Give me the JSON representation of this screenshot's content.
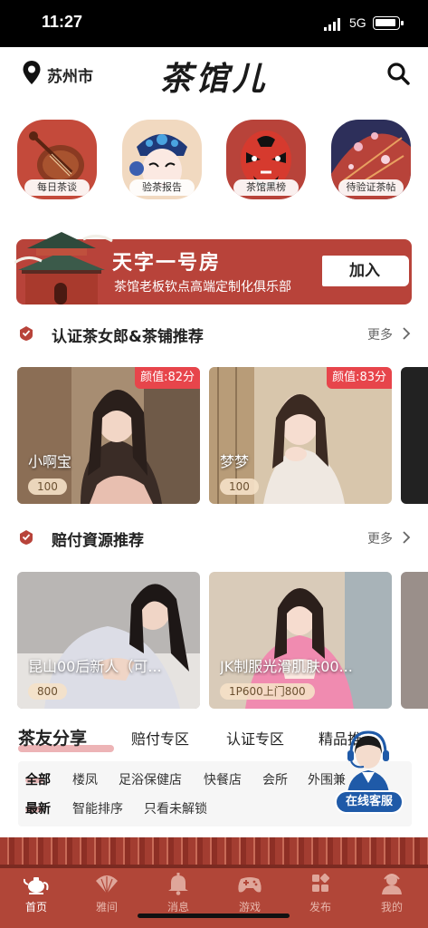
{
  "status_bar": {
    "time": "11:27",
    "network": "5G"
  },
  "header": {
    "city": "苏州市",
    "logo": "茶馆儿"
  },
  "categories": [
    {
      "label": "每日茶谈",
      "icon": "pipa-lute-icon"
    },
    {
      "label": "验茶报告",
      "icon": "opera-mask-blue-icon"
    },
    {
      "label": "茶馆黑榜",
      "icon": "opera-mask-red-icon"
    },
    {
      "label": "待验证茶帖",
      "icon": "paper-umbrella-icon"
    }
  ],
  "banner": {
    "title": "天字一号房",
    "subtitle": "茶馆老板钦点高端定制化俱乐部",
    "button": "加入"
  },
  "section1": {
    "title": "认证茶女郎&茶铺推荐",
    "more": "更多",
    "cards": [
      {
        "name": "小啊宝",
        "score": "颜值:82分",
        "price": "100"
      },
      {
        "name": "梦梦",
        "score": "颜值:83分",
        "price": "100"
      }
    ]
  },
  "section2": {
    "title": "赔付資源推荐",
    "more": "更多",
    "cards": [
      {
        "name": "昆山00后新人（可...",
        "price": "800"
      },
      {
        "name": "JK制服光滑肌肤00...",
        "price": "1P600上门800"
      }
    ]
  },
  "tabs": [
    "茶友分享",
    "赔付专区",
    "认证专区",
    "精品推"
  ],
  "filters": {
    "row1": [
      "全部",
      "楼凤",
      "足浴保健店",
      "快餐店",
      "会所",
      "外围兼"
    ],
    "row2": [
      "最新",
      "智能排序",
      "只看未解锁"
    ]
  },
  "service": {
    "label": "在线客服"
  },
  "bottom_nav": [
    {
      "label": "首页",
      "icon": "teapot-icon",
      "active": true
    },
    {
      "label": "雅间",
      "icon": "fan-icon",
      "active": false
    },
    {
      "label": "消息",
      "icon": "bell-icon",
      "active": false
    },
    {
      "label": "游戏",
      "icon": "gamepad-icon",
      "active": false
    },
    {
      "label": "发布",
      "icon": "grid-icon",
      "active": false
    },
    {
      "label": "我的",
      "icon": "profile-icon",
      "active": false
    }
  ],
  "colors": {
    "brand_red": "#b8433a",
    "score_red": "#e7454b",
    "service_blue": "#1f5aa8"
  }
}
